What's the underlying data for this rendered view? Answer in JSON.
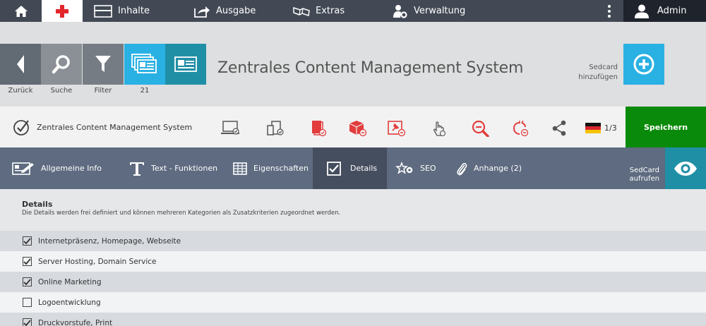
{
  "topnav": {
    "items": [
      {
        "label": "Inhalte",
        "icon": "layout-icon"
      },
      {
        "label": "Ausgabe",
        "icon": "share-out-icon"
      },
      {
        "label": "Extras",
        "icon": "puzzle-icon"
      },
      {
        "label": "Verwaltung",
        "icon": "user-cog-icon"
      }
    ],
    "admin": "Admin"
  },
  "toolbar": {
    "back": "Zurück",
    "search": "Suche",
    "filter": "Filter",
    "count": "21",
    "title": "Zentrales Content Management System",
    "add_line1": "Sedcard",
    "add_line2": "hinzufügen"
  },
  "actionbar": {
    "title": "Zentrales Content Management System",
    "language_count": "1/3",
    "save": "Speichern"
  },
  "tabs": {
    "items": [
      {
        "label": "Allgemeine Info"
      },
      {
        "label": "Text - Funktionen"
      },
      {
        "label": "Eigenschaften"
      },
      {
        "label": "Details"
      },
      {
        "label": "SEO"
      },
      {
        "label": "Anhange (2)"
      }
    ],
    "view_line1": "SedCard",
    "view_line2": "aufrufen"
  },
  "details": {
    "heading": "Details",
    "description": "Die Details werden frei definiert und können mehreren Kategorien als Zusatzkriterien zugeordnet werden.",
    "rows": [
      {
        "label": "Internetpräsenz, Homepage, Webseite",
        "checked": true
      },
      {
        "label": "Server Hosting, Domain Service",
        "checked": true
      },
      {
        "label": "Online Marketing",
        "checked": true
      },
      {
        "label": "Logoentwicklung",
        "checked": false
      },
      {
        "label": "Druckvorstufe, Print",
        "checked": true
      }
    ]
  },
  "colors": {
    "topnav": "#424955",
    "admin": "#1f242c",
    "accent_blue": "#2ab1e4",
    "teal": "#1f8fa6",
    "save_green": "#0a8a0a",
    "tabs": "#5e6b80",
    "tab_active": "#454e5e",
    "red_icon": "#e23c3c"
  }
}
